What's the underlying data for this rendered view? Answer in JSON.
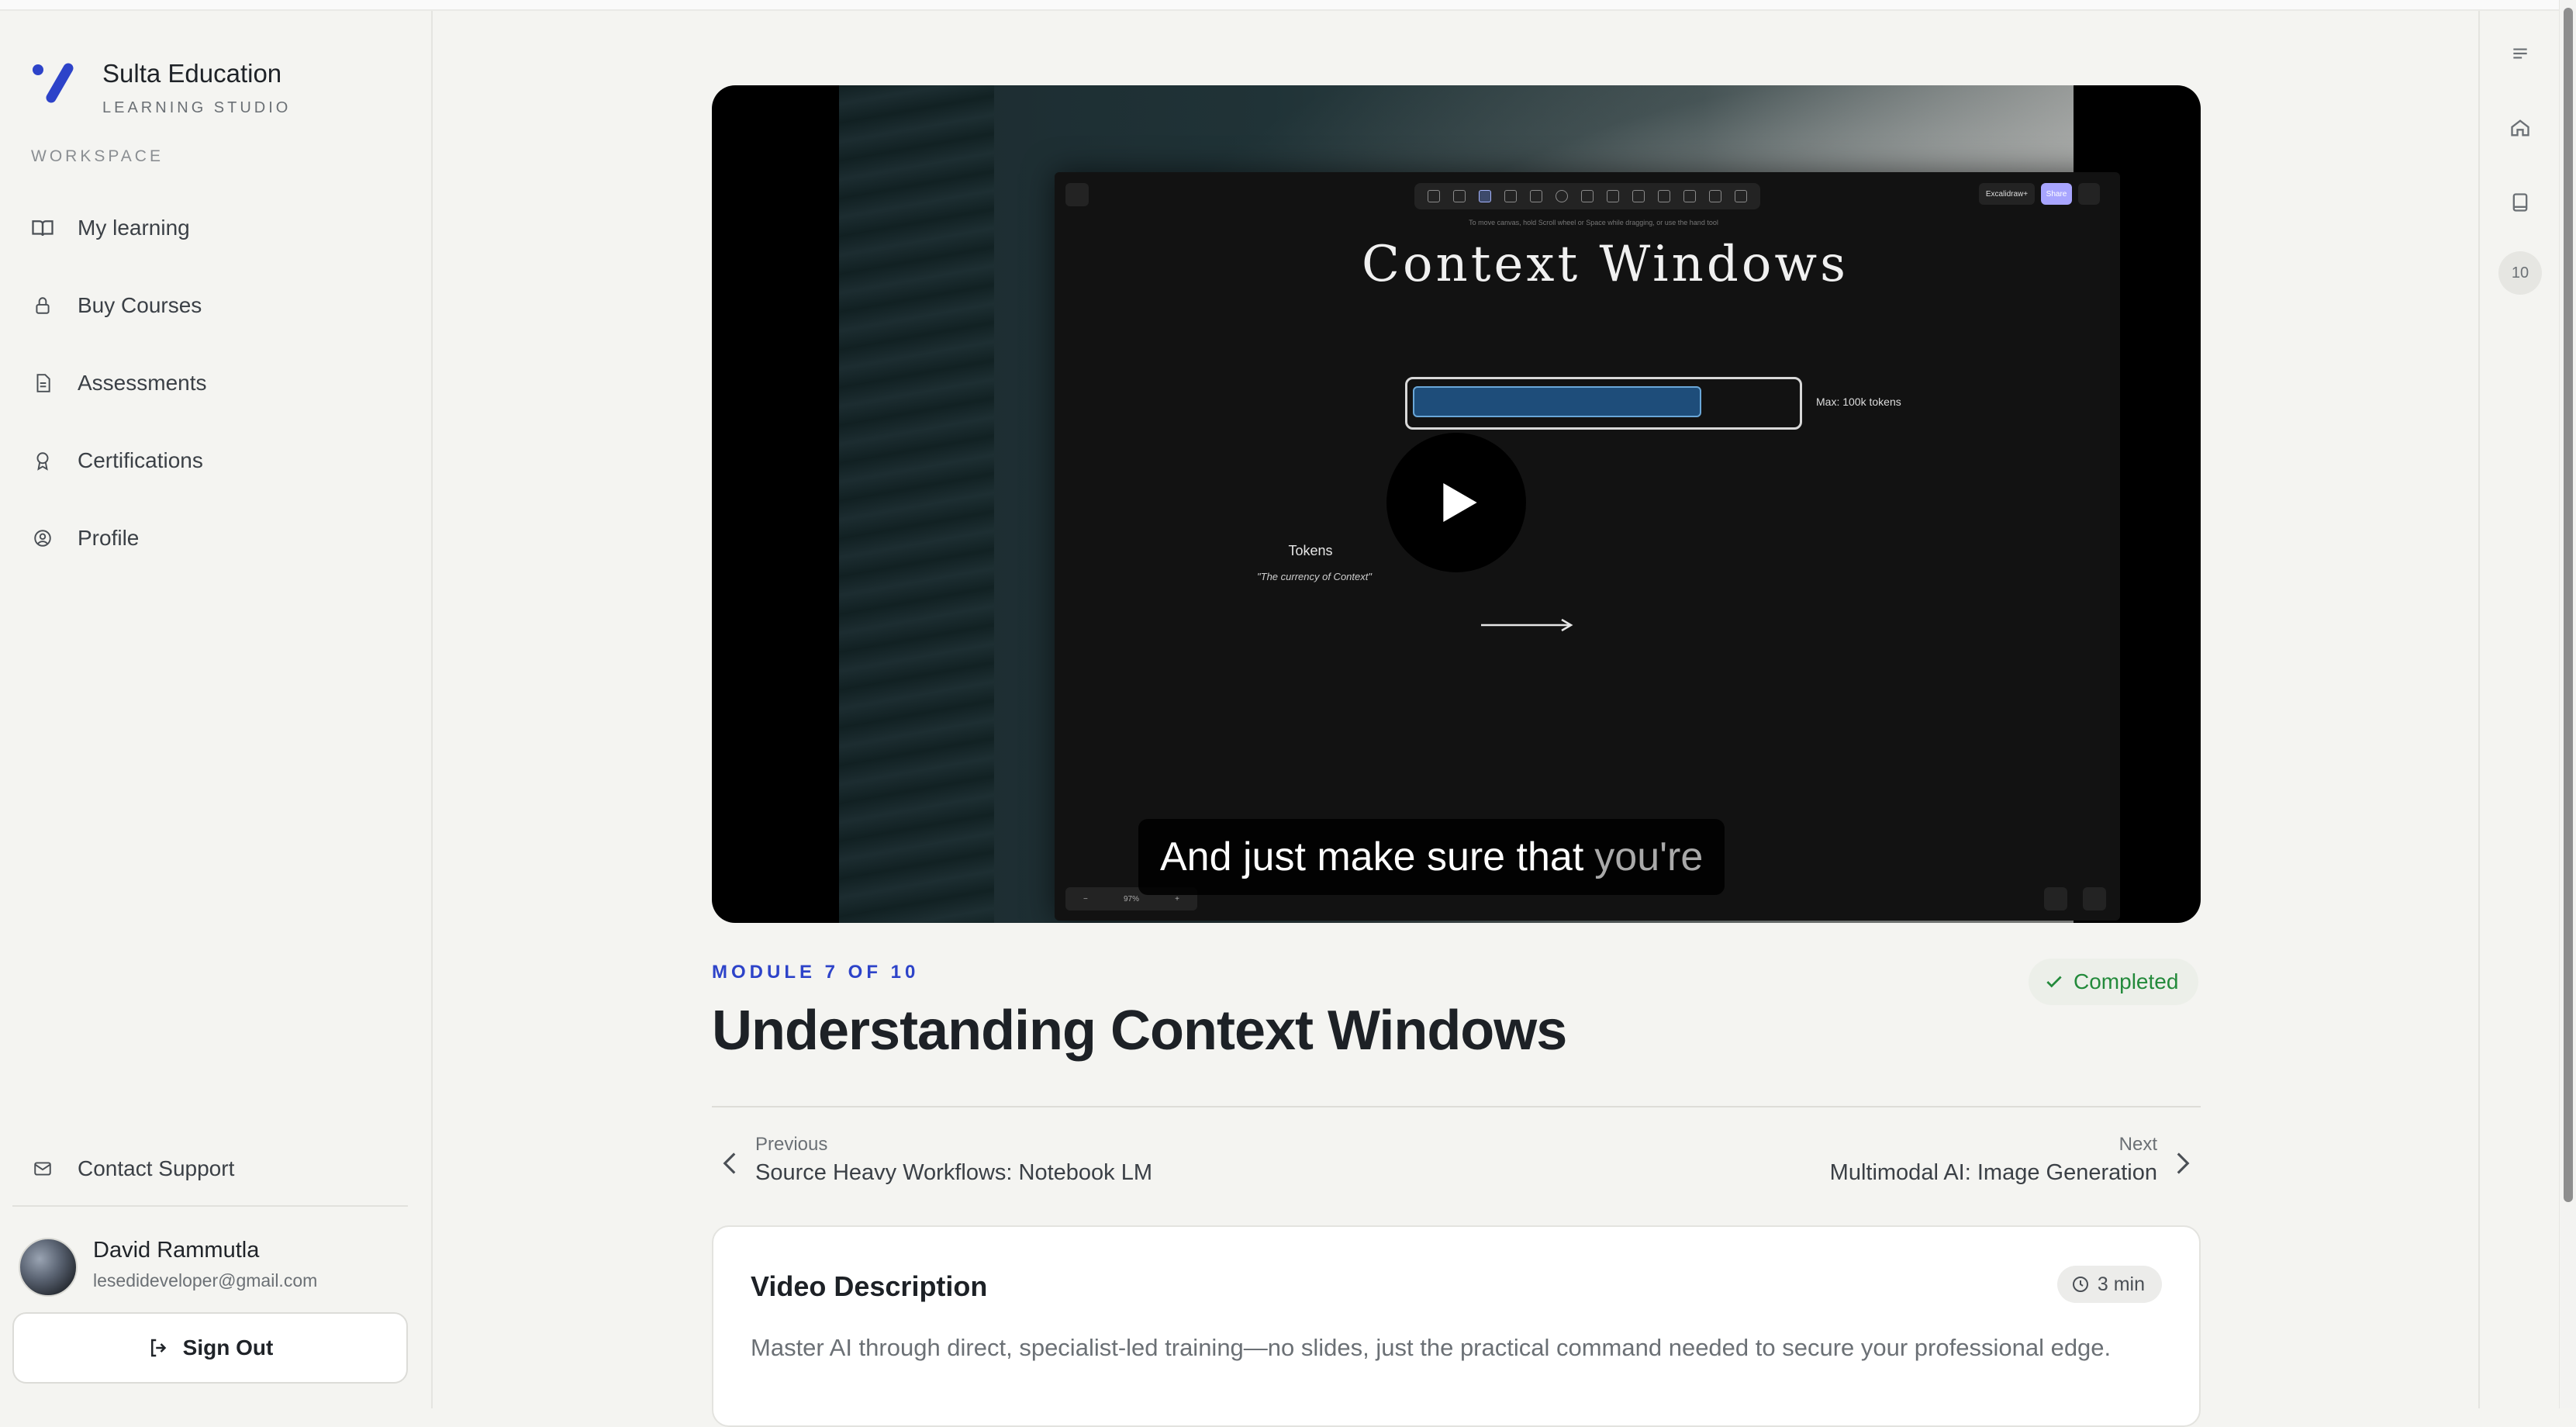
{
  "brand": {
    "name": "Sulta Education",
    "subtitle": "LEARNING STUDIO"
  },
  "sidebar": {
    "section_label": "WORKSPACE",
    "items": [
      {
        "label": "My learning",
        "icon": "book-open-icon"
      },
      {
        "label": "Buy Courses",
        "icon": "lock-icon"
      },
      {
        "label": "Assessments",
        "icon": "document-icon"
      },
      {
        "label": "Certifications",
        "icon": "award-icon"
      },
      {
        "label": "Profile",
        "icon": "user-circle-icon"
      }
    ],
    "contact_label": "Contact Support",
    "user": {
      "name": "David Rammutla",
      "email": "lesedideveloper@gmail.com"
    },
    "sign_out_label": "Sign Out"
  },
  "rail": {
    "module_count": "10"
  },
  "video": {
    "canvas_title": "Context Windows",
    "context_label": "Max: 100k tokens",
    "tokens_label": "Tokens",
    "tokens_sub": "\"The currency of Context\"",
    "hint_text": "To move canvas, hold Scroll wheel or Space while dragging, or use the hand tool",
    "excalidraw_label": "Excalidraw+",
    "share_label": "Share",
    "zoom_label": "97%",
    "caption_main": "And just make sure that",
    "caption_dim": "you're"
  },
  "module": {
    "label": "MODULE 7 OF 10",
    "status": "Completed",
    "title": "Understanding Context Windows"
  },
  "navigation": {
    "prev_label": "Previous",
    "prev_title": "Source Heavy Workflows: Notebook LM",
    "next_label": "Next",
    "next_title": "Multimodal AI: Image Generation"
  },
  "description": {
    "heading": "Video Description",
    "duration": "3 min",
    "text": "Master AI through direct, specialist-led training—no slides, just the practical command needed to secure your professional edge."
  },
  "colors": {
    "accent": "#2d43c9",
    "success": "#238a3b",
    "background": "#f4f4f1"
  }
}
